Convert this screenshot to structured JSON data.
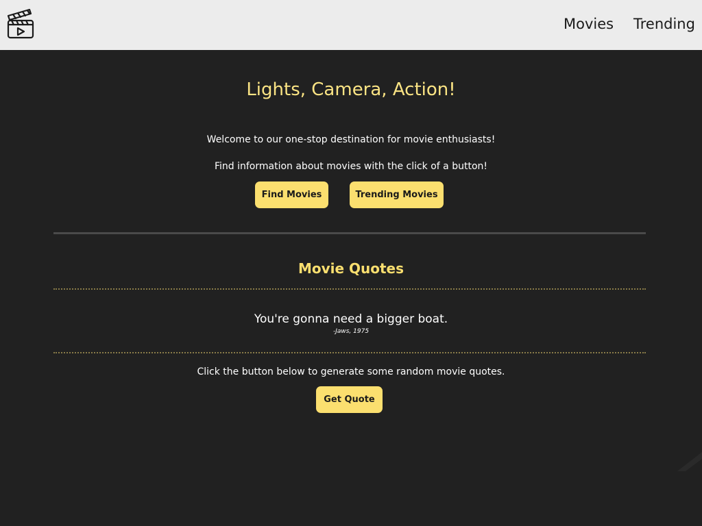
{
  "nav": {
    "logo_icon": "clapperboard-icon",
    "links": [
      "Movies",
      "Trending"
    ]
  },
  "hero": {
    "title": "Lights, Camera, Action!",
    "welcome": "Welcome to our one-stop destination for movie enthusiasts!",
    "info": "Find information about movies with the click of a button!",
    "buttons": [
      "Find Movies",
      "Trending Movies"
    ]
  },
  "quotes": {
    "title": "Movie Quotes",
    "quote": "You're gonna need a bigger boat.",
    "source": "-Jaws, 1975",
    "prompt": "Click the button below to generate some random movie quotes.",
    "button": "Get Quote"
  },
  "colors": {
    "background": "#212121",
    "navbar": "#ececec",
    "accent": "#fbdf6f",
    "title": "#fbe484"
  }
}
